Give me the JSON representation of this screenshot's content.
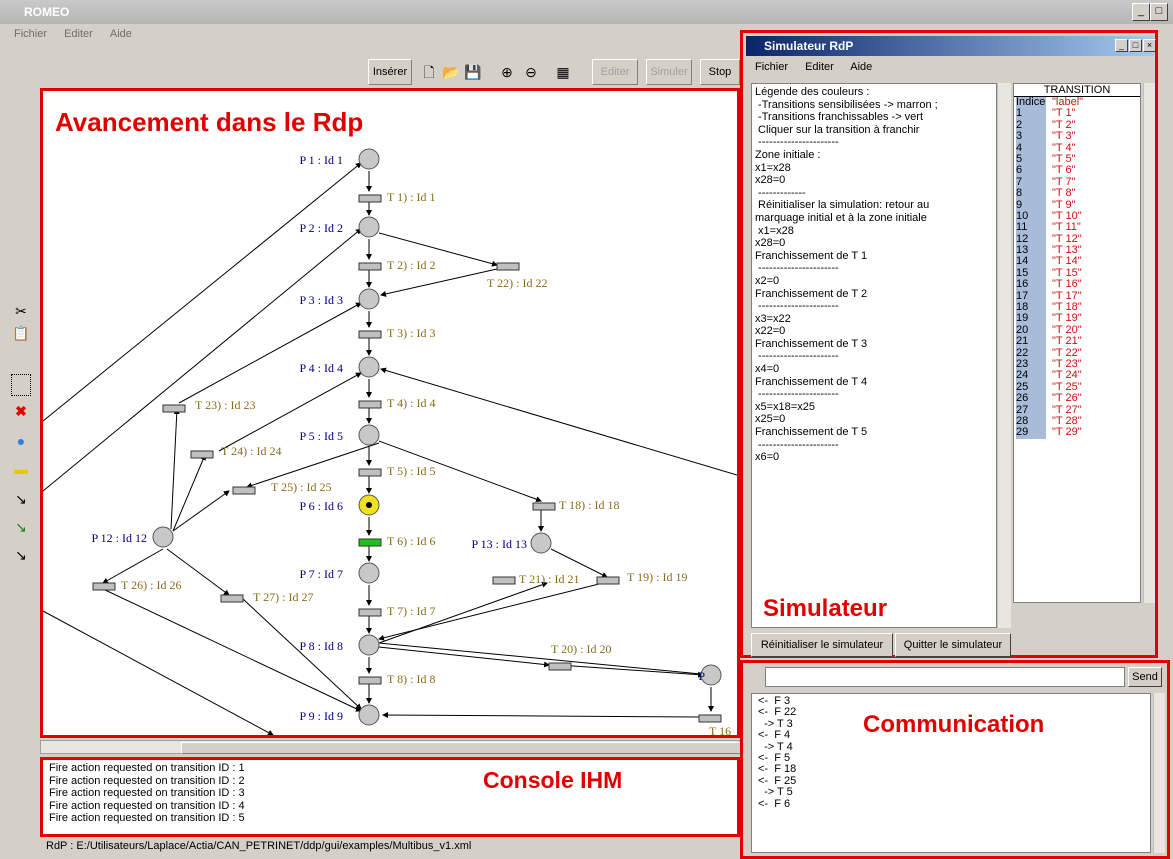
{
  "window": {
    "title": "ROMEO",
    "min": "_",
    "max": "□",
    "close": "×"
  },
  "menu": [
    "Fichier",
    "Editer",
    "Aide"
  ],
  "toolbar": {
    "insert": "Insérer",
    "edit": "Editer",
    "simulate": "Simuler",
    "stop": "Stop"
  },
  "annotations": {
    "canvas": "Avancement dans le Rdp",
    "simulator": "Simulateur",
    "console": "Console IHM",
    "communication": "Communication"
  },
  "petri": {
    "places": [
      {
        "label": "P 1 : Id 1"
      },
      {
        "label": "P 2 : Id 2"
      },
      {
        "label": "P 3 : Id 3"
      },
      {
        "label": "P 4 : Id 4"
      },
      {
        "label": "P 5 : Id 5"
      },
      {
        "label": "P 6 : Id 6"
      },
      {
        "label": "P 7 : Id 7"
      },
      {
        "label": "P 8 : Id 8"
      },
      {
        "label": "P 9 : Id 9"
      },
      {
        "label": "P 12 : Id 12"
      },
      {
        "label": "P 13 : Id 13"
      },
      {
        "label": "P"
      }
    ],
    "transitions": [
      {
        "label": "T 1) : Id 1"
      },
      {
        "label": "T 2) : Id 2"
      },
      {
        "label": "T 22) : Id 22"
      },
      {
        "label": "T 3) : Id 3"
      },
      {
        "label": "T 4) : Id 4"
      },
      {
        "label": "T 23) : Id 23"
      },
      {
        "label": "T 24) : Id 24"
      },
      {
        "label": "T 5) : Id 5"
      },
      {
        "label": "T 25) : Id 25"
      },
      {
        "label": "T 18) : Id 18"
      },
      {
        "label": "T 6) : Id 6"
      },
      {
        "label": "T 21) : Id 21"
      },
      {
        "label": "T 19) : Id 19"
      },
      {
        "label": "T 26) : Id 26"
      },
      {
        "label": "T 27) : Id 27"
      },
      {
        "label": "T 7) : Id 7"
      },
      {
        "label": "T 20) : Id 20"
      },
      {
        "label": "T 8) : Id 8"
      },
      {
        "label": "T 16"
      }
    ]
  },
  "console_lines": [
    "Fire action requested on transition ID : 1",
    "Fire action requested on transition ID : 2",
    "Fire action requested on transition ID : 3",
    "Fire action requested on transition ID : 4",
    "Fire action requested on transition ID : 5"
  ],
  "status": "RdP : E:/Utilisateurs/Laplace/Actia/CAN_PETRINET/ddp/gui/examples/Multibus_v1.xml",
  "simulator": {
    "title": "Simulateur RdP",
    "menu": [
      "Fichier",
      "Editer",
      "Aide"
    ],
    "legend_lines": [
      "Légende des couleurs :",
      " -Transitions sensibilisées -> marron ;",
      " -Transitions franchissables -> vert",
      " Cliquer sur la transition à franchir",
      " ----------------------",
      "Zone initiale :",
      "x1=x28",
      "x28=0",
      " -------------",
      " Réinitialiser la simulation: retour au",
      "marquage initial et à la zone initiale",
      " x1=x28",
      "x28=0",
      "Franchissement de T 1",
      " ----------------------",
      "x2=0",
      "Franchissement de T 2",
      " ----------------------",
      "x3=x22",
      "x22=0",
      "Franchissement de T 3",
      " ----------------------",
      "x4=0",
      "Franchissement de T 4",
      " ----------------------",
      "x5=x18=x25",
      "x25=0",
      "Franchissement de T 5",
      " ----------------------",
      "x6=0"
    ],
    "table_header": "TRANSITION",
    "col_index": "Indice",
    "col_label": "\"label\"",
    "rows": [
      {
        "i": "1",
        "l": "\"T 1\""
      },
      {
        "i": "2",
        "l": "\"T 2\""
      },
      {
        "i": "3",
        "l": "\"T 3\""
      },
      {
        "i": "4",
        "l": "\"T 4\""
      },
      {
        "i": "5",
        "l": "\"T 5\""
      },
      {
        "i": "6",
        "l": "\"T 6\""
      },
      {
        "i": "7",
        "l": "\"T 7\""
      },
      {
        "i": "8",
        "l": "\"T 8\""
      },
      {
        "i": "9",
        "l": "\"T 9\""
      },
      {
        "i": "10",
        "l": "\"T 10\""
      },
      {
        "i": "11",
        "l": "\"T 11\""
      },
      {
        "i": "12",
        "l": "\"T 12\""
      },
      {
        "i": "13",
        "l": "\"T 13\""
      },
      {
        "i": "14",
        "l": "\"T 14\""
      },
      {
        "i": "15",
        "l": "\"T 15\""
      },
      {
        "i": "16",
        "l": "\"T 16\""
      },
      {
        "i": "17",
        "l": "\"T 17\""
      },
      {
        "i": "18",
        "l": "\"T 18\""
      },
      {
        "i": "19",
        "l": "\"T 19\""
      },
      {
        "i": "20",
        "l": "\"T 20\""
      },
      {
        "i": "21",
        "l": "\"T 21\""
      },
      {
        "i": "22",
        "l": "\"T 22\""
      },
      {
        "i": "23",
        "l": "\"T 23\""
      },
      {
        "i": "24",
        "l": "\"T 24\""
      },
      {
        "i": "25",
        "l": "\"T 25\""
      },
      {
        "i": "26",
        "l": "\"T 26\""
      },
      {
        "i": "27",
        "l": "\"T 27\""
      },
      {
        "i": "28",
        "l": "\"T 28\""
      },
      {
        "i": "29",
        "l": "\"T 29\""
      }
    ],
    "reset_button": "Réinitialiser le simulateur",
    "quit_button": "Quitter le simulateur"
  },
  "communication": {
    "send": "Send",
    "lines": [
      "<-  F 3",
      "<-  F 22",
      "  -> T 3",
      "<-  F 4",
      "  -> T 4",
      "<-  F 5",
      "<-  F 18",
      "<-  F 25",
      "  -> T 5",
      "<-  F 6"
    ]
  },
  "colors": {
    "annotation_red": "#e10000",
    "token_yellow": "#f0e020",
    "fireable_green": "#20c020",
    "place_gray": "#c8c8c8"
  }
}
